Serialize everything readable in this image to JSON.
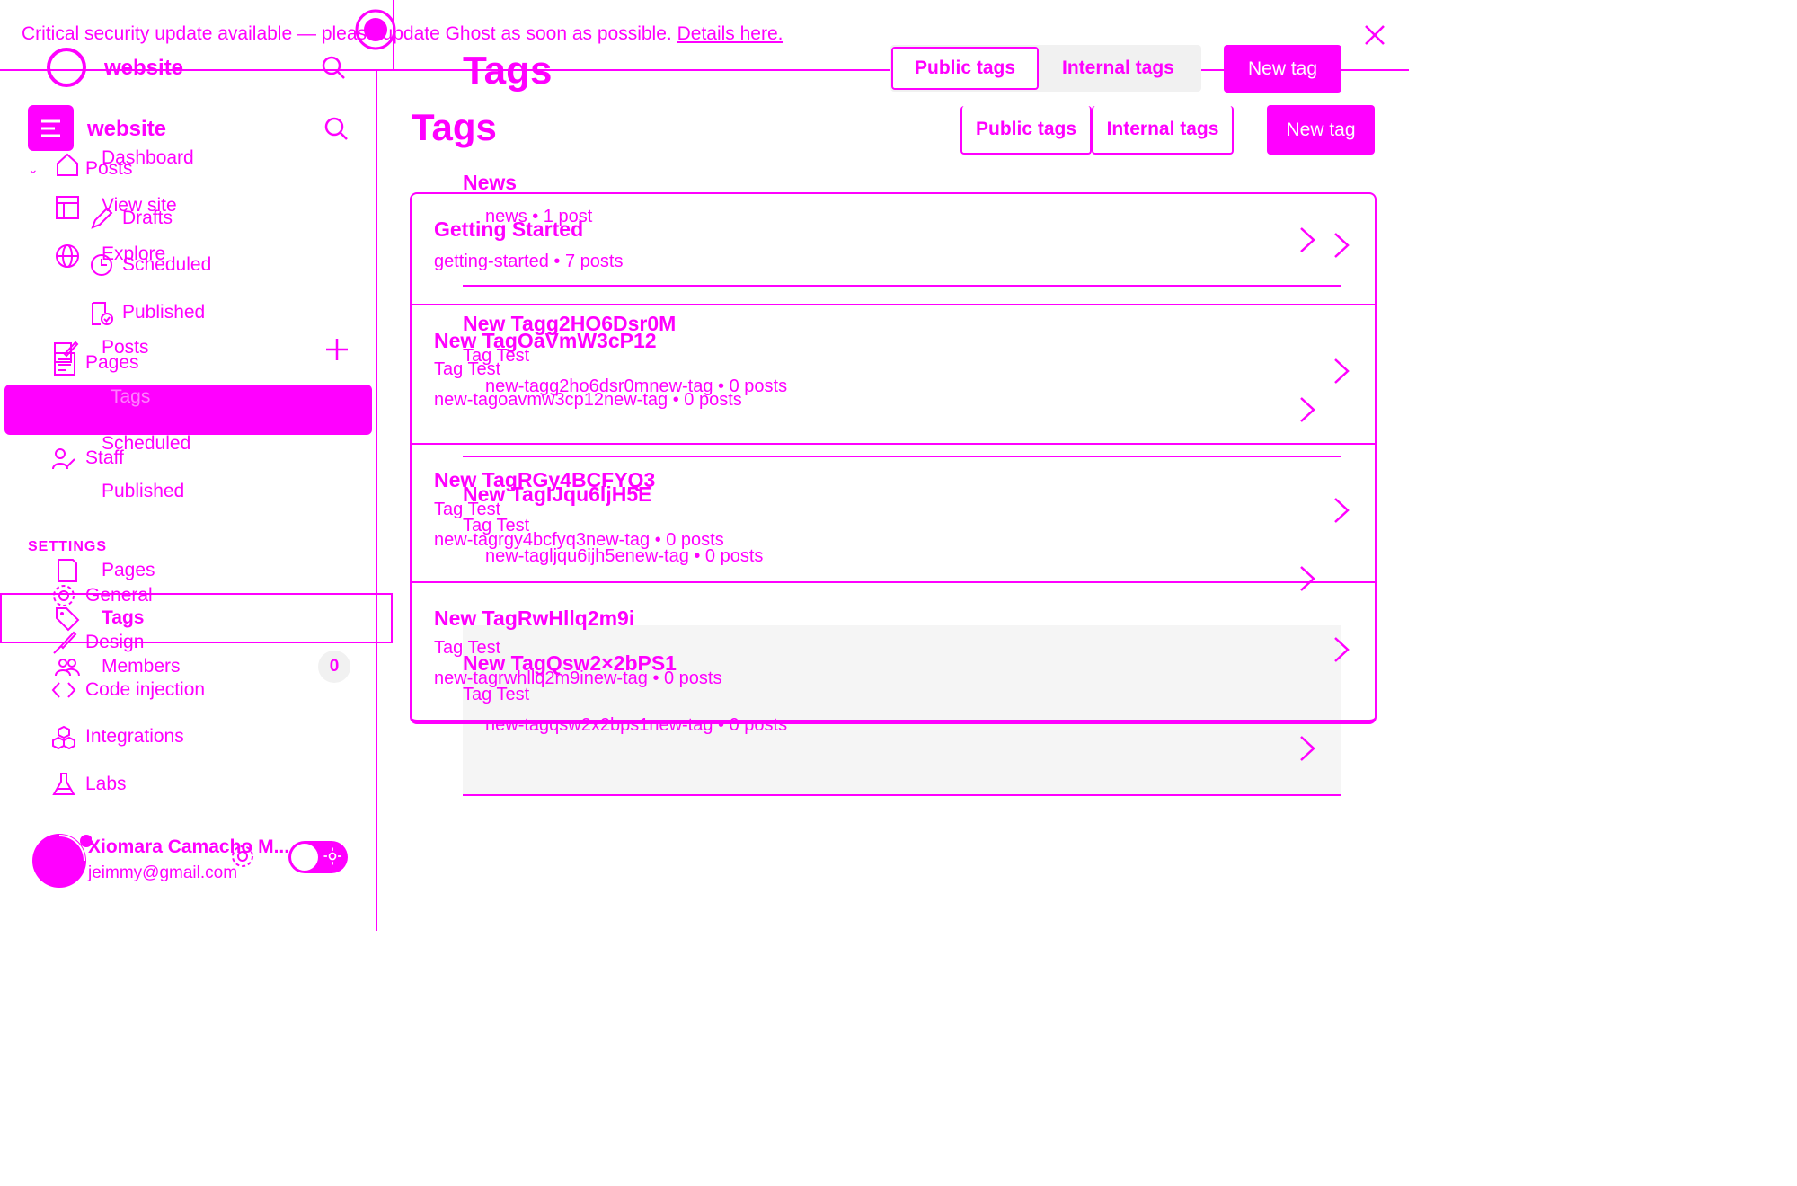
{
  "banner": {
    "text": "Critical security update available — please update Ghost as soon as possible.",
    "link": "Details here."
  },
  "ghost_header": {
    "site_name": "website",
    "page_title": "Tags",
    "tab_public": "Public tags",
    "tab_internal": "Internal tags",
    "new_tag": "New tag"
  },
  "sidebar": {
    "site_name": "website",
    "nav": {
      "dashboard": "Dashboard",
      "view_site": "View site",
      "explore": "Explore",
      "posts": "Posts",
      "drafts": "Drafts",
      "scheduled": "Scheduled",
      "published": "Published",
      "pages": "Pages",
      "tags": "Tags",
      "members": "Members",
      "members_count": "0",
      "staff": "Staff",
      "posts_sub_scheduled": "Scheduled",
      "posts_sub_published": "Published",
      "pages2": "Pages",
      "tags2": "Tags"
    },
    "settings": {
      "heading": "SETTINGS",
      "general": "General",
      "design": "Design",
      "code_injection": "Code injection",
      "integrations": "Integrations",
      "labs": "Labs"
    },
    "user": {
      "name": "Xiomara Camacho M...",
      "email": "jeimmy@gmail.com"
    },
    "posts_collapsed": "Posts"
  },
  "main": {
    "title": "Tags",
    "tab_public": "Public tags",
    "tab_internal": "Internal tags",
    "new_tag": "New tag"
  },
  "tags_list": [
    {
      "name": "Getting Started",
      "meta": "getting-started • 7 posts"
    },
    {
      "name": "New TagOaVmW3cP12",
      "desc": "Tag Test",
      "meta": "new-tagoavmw3cp12new-tag • 0 posts"
    },
    {
      "name": "New TagRGy4BCFYQ3",
      "desc": "Tag Test",
      "meta": "new-tagrgy4bcfyq3new-tag • 0 posts"
    },
    {
      "name": "New TagRwHllq2m9i",
      "desc": "Tag Test",
      "meta": "new-tagrwhllq2m9inew-tag • 0 posts"
    }
  ],
  "ghost_list": [
    {
      "name": "News",
      "meta": "news • 1 post"
    },
    {
      "name": "New Tagg2HO6Dsr0M",
      "desc": "Tag Test",
      "meta": "new-tagg2ho6dsr0mnew-tag • 0 posts"
    },
    {
      "name": "New TagIJqu6ljH5E",
      "desc": "Tag Test",
      "meta": "new-tagljqu6ijh5enew-tag • 0 posts"
    },
    {
      "name": "New TagQsw2×2bPS1",
      "desc": "Tag Test",
      "meta": "new-tagqsw2x2bps1new-tag • 0 posts"
    }
  ],
  "colors": {
    "accent": "#ff00ff",
    "background": "#ffffff"
  }
}
